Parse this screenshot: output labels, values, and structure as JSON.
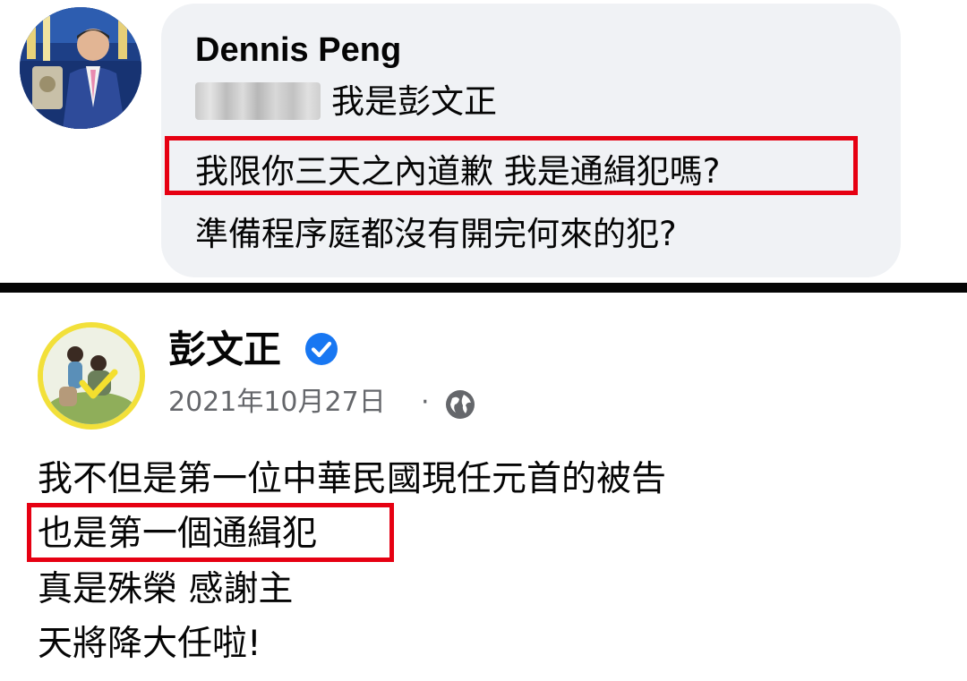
{
  "comment": {
    "author": "Dennis Peng",
    "lines": [
      "我是彭文正",
      "我限你三天之內道歉 我是通緝犯嗎?",
      "準備程序庭都沒有開完何來的犯?"
    ]
  },
  "post": {
    "author": "彭文正",
    "date": "2021年10月27日",
    "separator": "·",
    "icons": {
      "verified": "verified-badge-icon",
      "audience": "globe-icon"
    },
    "lines": [
      "我不但是第一位中華民國現任元首的被告",
      "也是第一個通緝犯",
      "真是殊榮 感謝主",
      "天將降大任啦!"
    ]
  },
  "colors": {
    "highlight": "#e60012",
    "bubble": "#f0f2f5",
    "divider": "#050505",
    "verified": "#1877f2",
    "meta_text": "#65676b"
  }
}
